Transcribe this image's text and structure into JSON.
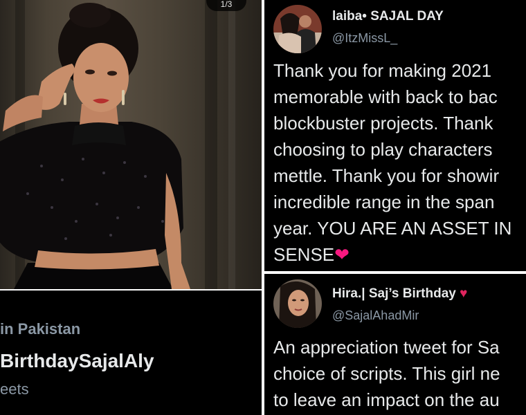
{
  "photo": {
    "counter": "1/3"
  },
  "trend": {
    "context": "in Pakistan",
    "name": "BirthdaySajalAly",
    "count": "eets"
  },
  "tweets": [
    {
      "display_name": "laiba• SAJAL DAY",
      "handle": "@ItzMissL_",
      "text_lines": [
        "Thank you for making 2021",
        "memorable with back to bac",
        "blockbuster projects. Thank",
        "choosing to play characters",
        "mettle. Thank you for showir",
        "incredible range in the span",
        "year. YOU ARE AN ASSET IN",
        "SENSE"
      ],
      "emoji": "❤"
    },
    {
      "display_name": "Hira.| Saj’s Birthday",
      "handle": "@SajalAhadMir",
      "name_emoji": "♥",
      "text_lines": [
        "An appreciation tweet for Sa",
        "choice of scripts. This girl ne",
        "to leave an impact on the au"
      ]
    }
  ],
  "colors": {
    "background": "#000000",
    "primary_text": "#e7e9ea",
    "secondary_text": "#8b98a5",
    "heart": "#f91880"
  }
}
